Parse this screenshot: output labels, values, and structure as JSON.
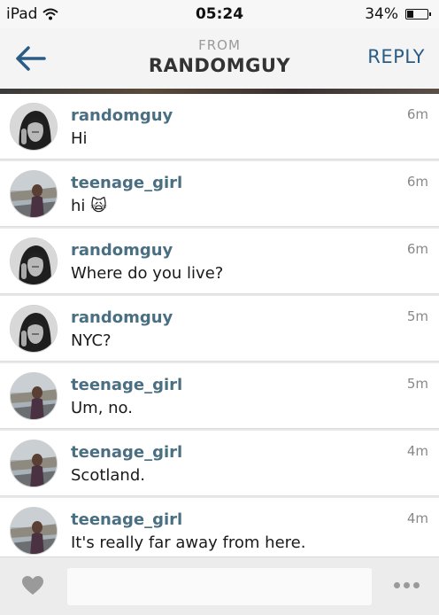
{
  "status_bar": {
    "device": "iPad",
    "time": "05:24",
    "battery": "34%",
    "battery_level": 0.34
  },
  "header": {
    "from_label": "FROM",
    "title": "RANDOMGUY",
    "reply_label": "REPLY",
    "back_icon": "back-arrow-icon"
  },
  "messages": [
    {
      "user": "randomguy",
      "text": "Hi",
      "time": "6m",
      "avatar": "randomguy"
    },
    {
      "user": "teenage_girl",
      "text": "hi 🙀",
      "time": "6m",
      "avatar": "teenage_girl"
    },
    {
      "user": "randomguy",
      "text": "Where do you live?",
      "time": "6m",
      "avatar": "randomguy"
    },
    {
      "user": "randomguy",
      "text": "NYC?",
      "time": "5m",
      "avatar": "randomguy"
    },
    {
      "user": "teenage_girl",
      "text": "Um, no.",
      "time": "5m",
      "avatar": "teenage_girl"
    },
    {
      "user": "teenage_girl",
      "text": "Scotland.",
      "time": "4m",
      "avatar": "teenage_girl"
    },
    {
      "user": "teenage_girl",
      "text": "It's really far away from here.",
      "time": "4m",
      "avatar": "teenage_girl"
    }
  ],
  "composer": {
    "input_value": "",
    "input_placeholder": "",
    "heart_icon": "heart-icon",
    "more_icon": "more-dots-icon"
  },
  "colors": {
    "accent": "#2b5c85",
    "username": "#4a6f82",
    "background": "#e9e9e9"
  }
}
